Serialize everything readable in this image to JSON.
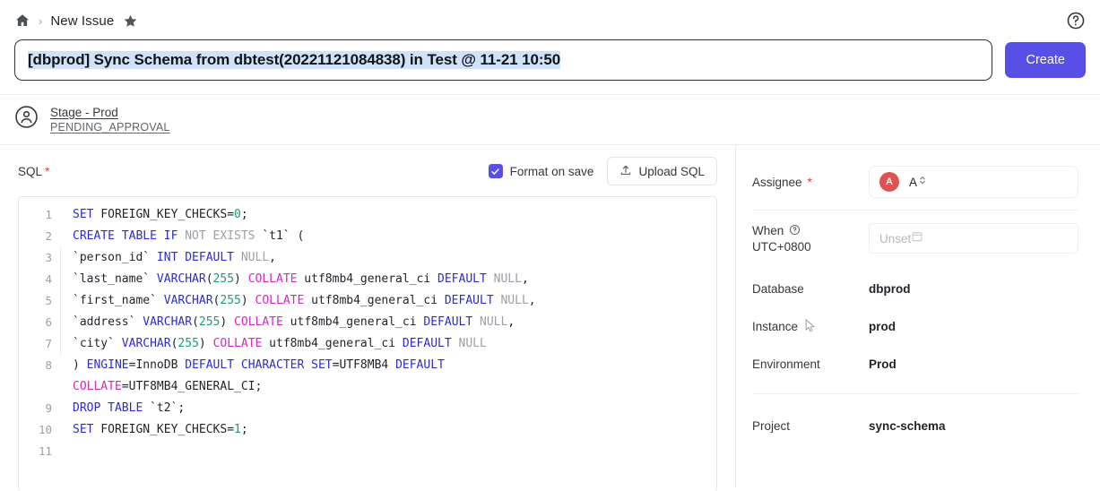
{
  "breadcrumb": {
    "home_icon": "home-icon",
    "separator": "›",
    "title": "New Issue",
    "star_icon": "star-icon"
  },
  "header": {
    "help_icon": "help-circle-icon",
    "issue_title": "[dbprod] Sync Schema from dbtest(20221121084838) in Test @ 11-21 10:50",
    "create_label": "Create"
  },
  "stage": {
    "avatar_icon": "user-circle-icon",
    "name": "Stage - Prod",
    "status": "PENDING_APPROVAL"
  },
  "sql_section": {
    "label": "SQL",
    "required_mark": "*",
    "format_on_save_label": "Format on save",
    "format_on_save_checked": true,
    "check_icon": "check-icon",
    "upload_icon": "upload-icon",
    "upload_label": "Upload SQL"
  },
  "editor": {
    "lines": [
      {
        "num": "1",
        "indent": false,
        "tokens": [
          {
            "t": "SET",
            "c": "kw"
          },
          {
            "t": " FOREIGN_KEY_CHECKS=",
            "c": "pln"
          },
          {
            "t": "0",
            "c": "num"
          },
          {
            "t": ";",
            "c": "pln"
          }
        ]
      },
      {
        "num": "2",
        "indent": false,
        "tokens": [
          {
            "t": "CREATE TABLE IF",
            "c": "kw"
          },
          {
            "t": " NOT EXISTS",
            "c": "kw2"
          },
          {
            "t": " `t1` (",
            "c": "pln"
          }
        ]
      },
      {
        "num": "3",
        "indent": true,
        "tokens": [
          {
            "t": "`person_id`",
            "c": "pln"
          },
          {
            "t": " INT DEFAULT",
            "c": "kw"
          },
          {
            "t": " NULL",
            "c": "kw2"
          },
          {
            "t": ",",
            "c": "pln"
          }
        ]
      },
      {
        "num": "4",
        "indent": true,
        "tokens": [
          {
            "t": "`last_name`",
            "c": "pln"
          },
          {
            "t": " VARCHAR",
            "c": "kw"
          },
          {
            "t": "(",
            "c": "pln"
          },
          {
            "t": "255",
            "c": "num"
          },
          {
            "t": ") ",
            "c": "pln"
          },
          {
            "t": "COLLATE",
            "c": "mag"
          },
          {
            "t": " utf8mb4_general_ci",
            "c": "pln"
          },
          {
            "t": " DEFAULT",
            "c": "kw"
          },
          {
            "t": " NULL",
            "c": "kw2"
          },
          {
            "t": ",",
            "c": "pln"
          }
        ]
      },
      {
        "num": "5",
        "indent": true,
        "tokens": [
          {
            "t": "`first_name`",
            "c": "pln"
          },
          {
            "t": " VARCHAR",
            "c": "kw"
          },
          {
            "t": "(",
            "c": "pln"
          },
          {
            "t": "255",
            "c": "num"
          },
          {
            "t": ") ",
            "c": "pln"
          },
          {
            "t": "COLLATE",
            "c": "mag"
          },
          {
            "t": " utf8mb4_general_ci",
            "c": "pln"
          },
          {
            "t": " DEFAULT",
            "c": "kw"
          },
          {
            "t": " NULL",
            "c": "kw2"
          },
          {
            "t": ",",
            "c": "pln"
          }
        ]
      },
      {
        "num": "6",
        "indent": true,
        "tokens": [
          {
            "t": "`address`",
            "c": "pln"
          },
          {
            "t": " VARCHAR",
            "c": "kw"
          },
          {
            "t": "(",
            "c": "pln"
          },
          {
            "t": "255",
            "c": "num"
          },
          {
            "t": ") ",
            "c": "pln"
          },
          {
            "t": "COLLATE",
            "c": "mag"
          },
          {
            "t": " utf8mb4_general_ci",
            "c": "pln"
          },
          {
            "t": " DEFAULT",
            "c": "kw"
          },
          {
            "t": " NULL",
            "c": "kw2"
          },
          {
            "t": ",",
            "c": "pln"
          }
        ]
      },
      {
        "num": "7",
        "indent": true,
        "tokens": [
          {
            "t": "`city`",
            "c": "pln"
          },
          {
            "t": " VARCHAR",
            "c": "kw"
          },
          {
            "t": "(",
            "c": "pln"
          },
          {
            "t": "255",
            "c": "num"
          },
          {
            "t": ") ",
            "c": "pln"
          },
          {
            "t": "COLLATE",
            "c": "mag"
          },
          {
            "t": " utf8mb4_general_ci",
            "c": "pln"
          },
          {
            "t": " DEFAULT",
            "c": "kw"
          },
          {
            "t": " NULL",
            "c": "kw2"
          }
        ]
      },
      {
        "num": "8",
        "indent": false,
        "tokens": [
          {
            "t": ") ",
            "c": "pln"
          },
          {
            "t": "ENGINE",
            "c": "kw"
          },
          {
            "t": "=InnoDB ",
            "c": "pln"
          },
          {
            "t": "DEFAULT CHARACTER SET",
            "c": "kw"
          },
          {
            "t": "=UTF8MB4 ",
            "c": "pln"
          },
          {
            "t": "DEFAULT",
            "c": "kw"
          }
        ]
      },
      {
        "num": "",
        "indent": false,
        "tokens": [
          {
            "t": "COLLATE",
            "c": "mag"
          },
          {
            "t": "=UTF8MB4_GENERAL_CI;",
            "c": "pln"
          }
        ]
      },
      {
        "num": "9",
        "indent": false,
        "tokens": [
          {
            "t": "DROP TABLE",
            "c": "kw"
          },
          {
            "t": " `t2`;",
            "c": "pln"
          }
        ]
      },
      {
        "num": "10",
        "indent": false,
        "tokens": [
          {
            "t": "SET",
            "c": "kw"
          },
          {
            "t": " FOREIGN_KEY_CHECKS=",
            "c": "pln"
          },
          {
            "t": "1",
            "c": "num"
          },
          {
            "t": ";",
            "c": "pln"
          }
        ]
      },
      {
        "num": "11",
        "indent": false,
        "tokens": []
      }
    ]
  },
  "sidebar": {
    "assignee": {
      "label": "Assignee",
      "required_mark": "*",
      "avatar_initial": "A",
      "avatar_color": "#e05252",
      "value": "A",
      "chevron_icon": "chevron-up-down-icon"
    },
    "when": {
      "label": "When",
      "help_icon": "question-circle-icon",
      "timezone": "UTC+0800",
      "placeholder": "Unset",
      "calendar_icon": "calendar-icon"
    },
    "database": {
      "label": "Database",
      "value": "dbprod"
    },
    "instance": {
      "label": "Instance",
      "value": "prod",
      "cursor_icon": "mouse-cursor-icon"
    },
    "environment": {
      "label": "Environment",
      "value": "Prod"
    },
    "project": {
      "label": "Project",
      "value": "sync-schema"
    }
  },
  "colors": {
    "accent": "#5850e6",
    "selection": "#cfe2f7",
    "avatar": "#e05252",
    "required": "#e03a3a"
  }
}
